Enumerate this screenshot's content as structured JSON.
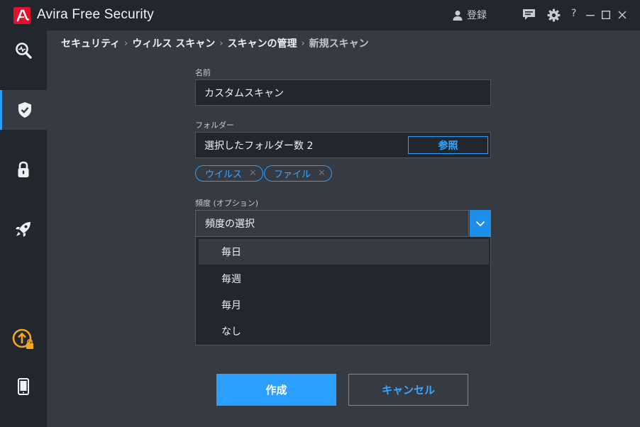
{
  "app": {
    "title": "Avira Free Security",
    "login_label": "登録"
  },
  "breadcrumb": [
    "セキュリティ",
    "ウィルス スキャン",
    "スキャンの管理",
    "新規スキャン"
  ],
  "form": {
    "name_label": "名前",
    "name_value": "カスタムスキャン",
    "folder_label": "フォルダー",
    "folder_value": "選択したフォルダー数 2",
    "browse_label": "参照",
    "chips": [
      "ウイルス",
      "ファイル"
    ],
    "frequency_label": "頻度 (オプション)",
    "frequency_placeholder": "頻度の選択",
    "frequency_options": [
      "毎日",
      "毎週",
      "毎月",
      "なし"
    ]
  },
  "actions": {
    "create_label": "作成",
    "cancel_label": "キャンセル"
  },
  "colors": {
    "accent": "#2b9fff",
    "brand": "#e3102b",
    "sidebar_bg": "#22262d",
    "content_bg": "#363a42"
  }
}
